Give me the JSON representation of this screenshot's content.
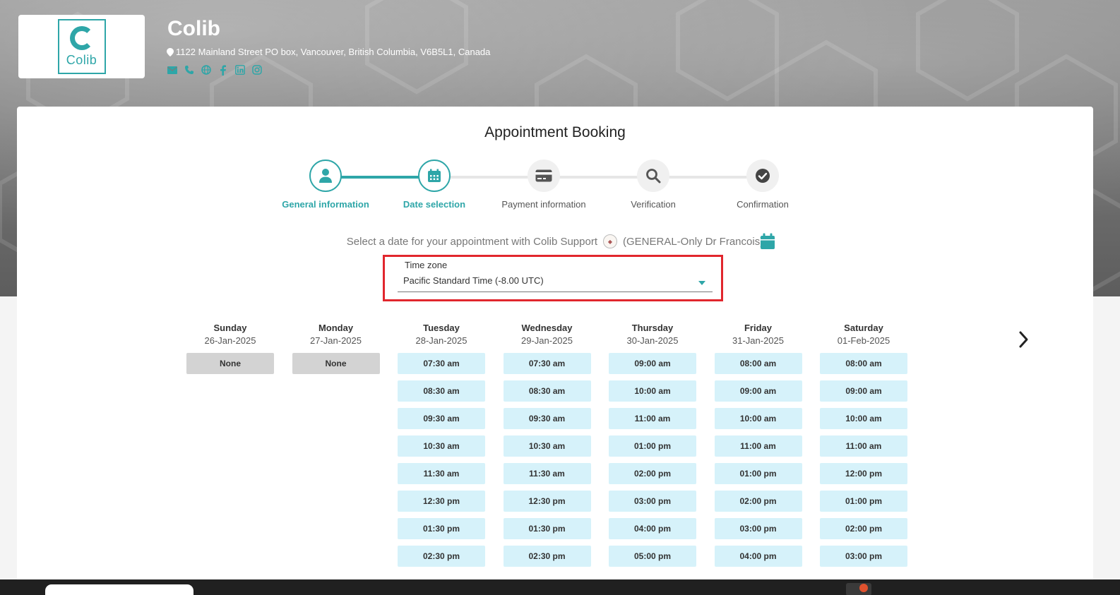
{
  "company": {
    "name": "Colib",
    "logo_text": "Colib",
    "address": "1122 Mainland Street PO box, Vancouver, British Columbia, V6B5L1, Canada",
    "social_icons": [
      "email-icon",
      "phone-icon",
      "globe-icon",
      "facebook-icon",
      "linkedin-icon",
      "instagram-icon"
    ]
  },
  "page": {
    "title": "Appointment Booking"
  },
  "steps": [
    {
      "label": "General information",
      "icon": "user-icon",
      "active": true
    },
    {
      "label": "Date selection",
      "icon": "calendar-icon",
      "active": true
    },
    {
      "label": "Payment information",
      "icon": "credit-card-icon",
      "active": false
    },
    {
      "label": "Verification",
      "icon": "search-icon",
      "active": false
    },
    {
      "label": "Confirmation",
      "icon": "check-circle-icon",
      "active": false
    }
  ],
  "selection": {
    "prefix": "Select a date for your appointment with Colib Support",
    "service": "(GENERAL-Only Dr Francois)"
  },
  "timezone": {
    "label": "Time zone",
    "value": "Pacific Standard Time (-8.00 UTC)"
  },
  "days": [
    {
      "name": "Sunday",
      "date": "26-Jan-2025",
      "slots": [
        "None"
      ]
    },
    {
      "name": "Monday",
      "date": "27-Jan-2025",
      "slots": [
        "None"
      ]
    },
    {
      "name": "Tuesday",
      "date": "28-Jan-2025",
      "slots": [
        "07:30 am",
        "08:30 am",
        "09:30 am",
        "10:30 am",
        "11:30 am",
        "12:30 pm",
        "01:30 pm",
        "02:30 pm"
      ]
    },
    {
      "name": "Wednesday",
      "date": "29-Jan-2025",
      "slots": [
        "07:30 am",
        "08:30 am",
        "09:30 am",
        "10:30 am",
        "11:30 am",
        "12:30 pm",
        "01:30 pm",
        "02:30 pm"
      ]
    },
    {
      "name": "Thursday",
      "date": "30-Jan-2025",
      "slots": [
        "09:00 am",
        "10:00 am",
        "11:00 am",
        "01:00 pm",
        "02:00 pm",
        "03:00 pm",
        "04:00 pm",
        "05:00 pm"
      ]
    },
    {
      "name": "Friday",
      "date": "31-Jan-2025",
      "slots": [
        "08:00 am",
        "09:00 am",
        "10:00 am",
        "11:00 am",
        "01:00 pm",
        "02:00 pm",
        "03:00 pm",
        "04:00 pm"
      ]
    },
    {
      "name": "Saturday",
      "date": "01-Feb-2025",
      "slots": [
        "08:00 am",
        "09:00 am",
        "10:00 am",
        "11:00 am",
        "12:00 pm",
        "01:00 pm",
        "02:00 pm",
        "03:00 pm"
      ]
    }
  ],
  "colors": {
    "accent": "#2ea6a8",
    "slot_bg": "#d6f2fa",
    "none_bg": "#d3d3d3",
    "highlight_border": "#e1262d"
  }
}
